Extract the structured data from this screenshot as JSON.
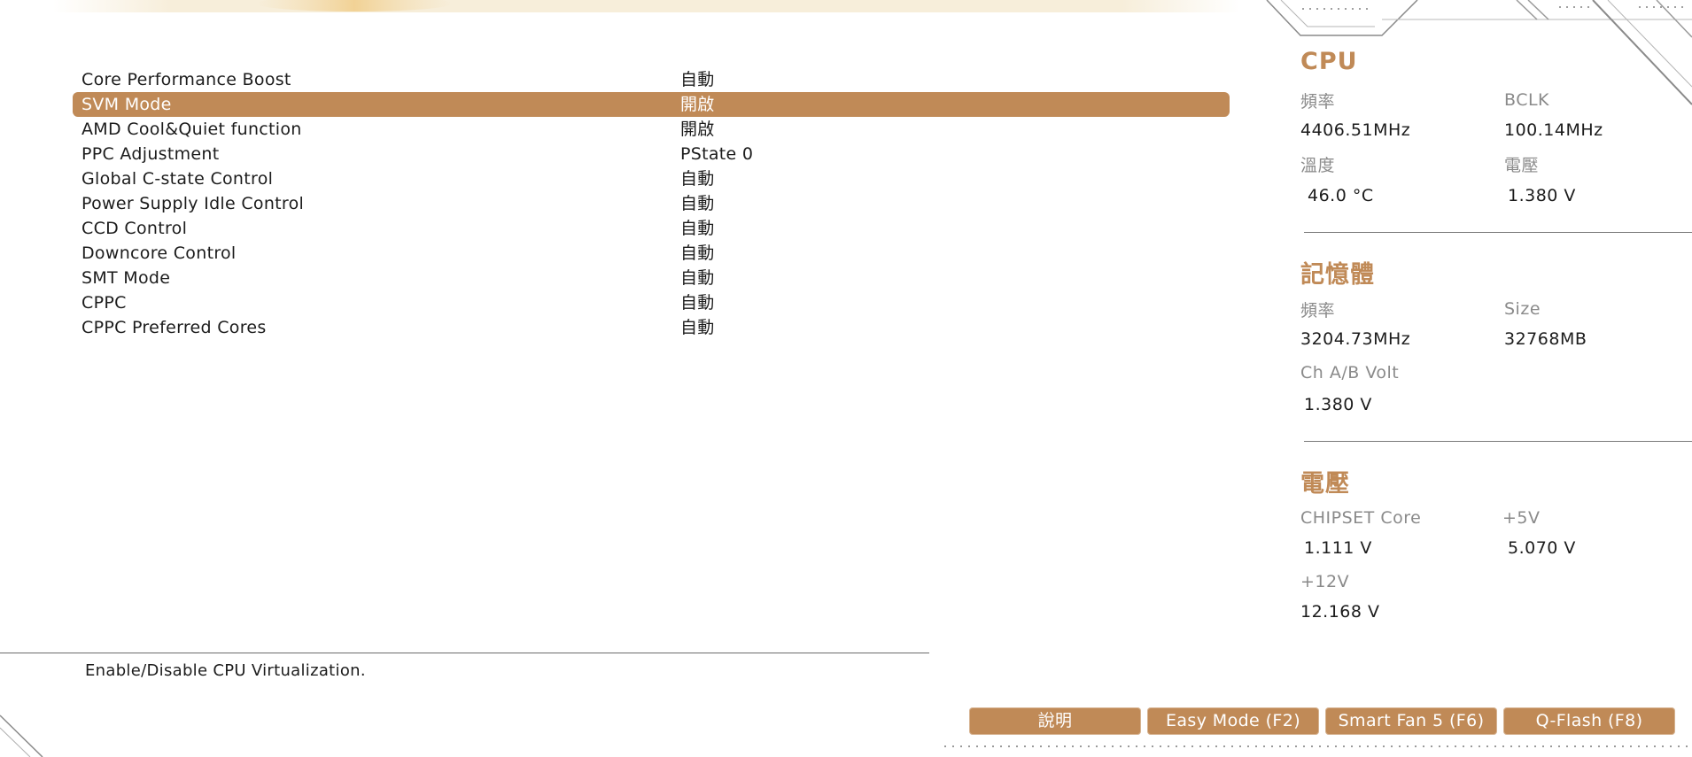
{
  "theme": {
    "accent": "#c08a57",
    "text": "#1c1c1c",
    "label_gray": "#8a8a8a"
  },
  "settings": [
    {
      "label": "Core Performance Boost",
      "value": "自動"
    },
    {
      "label": "SVM Mode",
      "value": "開啟",
      "selected": true
    },
    {
      "label": "AMD Cool&Quiet function",
      "value": "開啟"
    },
    {
      "label": "PPC Adjustment",
      "value": "PState 0"
    },
    {
      "label": "Global C-state Control",
      "value": "自動"
    },
    {
      "label": "Power Supply Idle Control",
      "value": "自動"
    },
    {
      "label": "CCD Control",
      "value": "自動"
    },
    {
      "label": "Downcore Control",
      "value": "自動"
    },
    {
      "label": "SMT Mode",
      "value": "自動"
    },
    {
      "label": "CPPC",
      "value": "自動"
    },
    {
      "label": "CPPC Preferred Cores",
      "value": "自動"
    }
  ],
  "help": {
    "text": "Enable/Disable CPU Virtualization."
  },
  "info": {
    "cpu": {
      "title": "CPU",
      "freq_label": "頻率",
      "freq_value": "4406.51MHz",
      "bclk_label": "BCLK",
      "bclk_value": "100.14MHz",
      "temp_label": "溫度",
      "temp_value": "46.0 °C",
      "volt_label": "電壓",
      "volt_value": "1.380 V"
    },
    "memory": {
      "title": "記憶體",
      "freq_label": "頻率",
      "freq_value": "3204.73MHz",
      "size_label": "Size",
      "size_value": "32768MB",
      "volt_label": "Ch A/B Volt",
      "volt_value": "1.380 V"
    },
    "voltage": {
      "title": "電壓",
      "chipset_label": "CHIPSET Core",
      "chipset_value": "1.111 V",
      "p5v_label": "+5V",
      "p5v_value": "5.070 V",
      "p12v_label": "+12V",
      "p12v_value": "12.168 V"
    }
  },
  "buttons": {
    "help": "說明",
    "easy_mode": "Easy Mode (F2)",
    "smart_fan": "Smart Fan 5 (F6)",
    "qflash": "Q-Flash (F8)"
  }
}
